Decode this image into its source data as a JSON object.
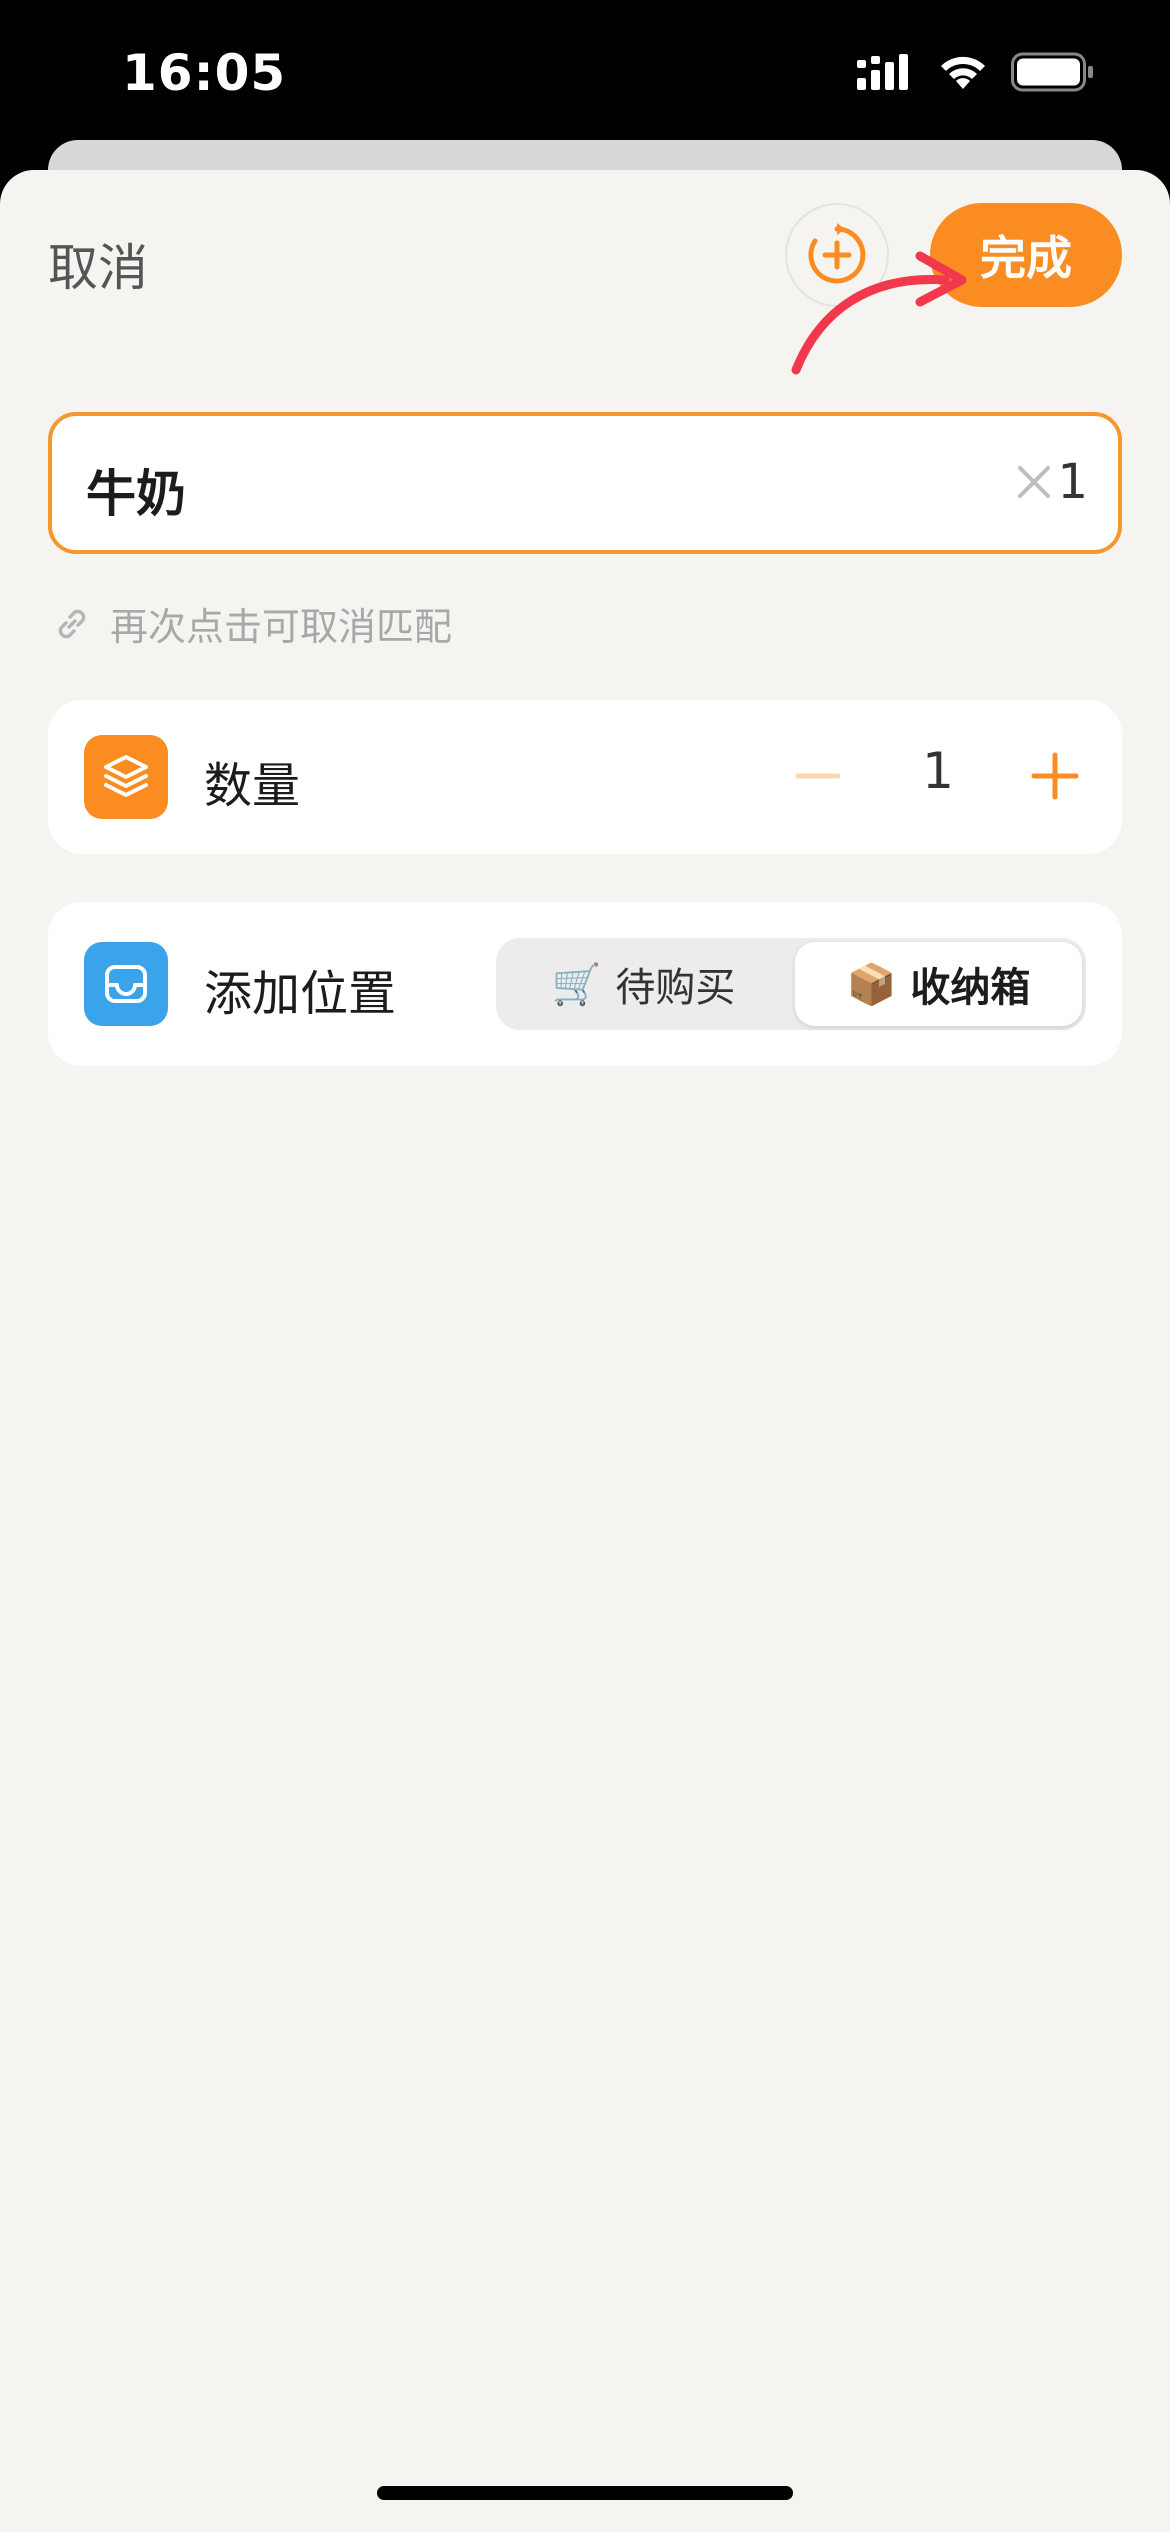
{
  "status_bar": {
    "time": "16:05"
  },
  "header": {
    "cancel_label": "取消",
    "done_label": "完成"
  },
  "name_field": {
    "value": "牛奶",
    "quantity_suffix": "1"
  },
  "hint": {
    "text": "再次点击可取消匹配"
  },
  "quantity_row": {
    "label": "数量",
    "value": "1"
  },
  "location_row": {
    "label": "添加位置",
    "options": [
      {
        "emoji": "🛒",
        "label": "待购买",
        "selected": false
      },
      {
        "emoji": "📦",
        "label": "收纳箱",
        "selected": true
      }
    ]
  },
  "colors": {
    "accent": "#fb8c22",
    "quantity_icon_bg": "#fb8c22",
    "location_icon_bg": "#3aa3ea",
    "annotation_arrow": "#f2384c"
  }
}
